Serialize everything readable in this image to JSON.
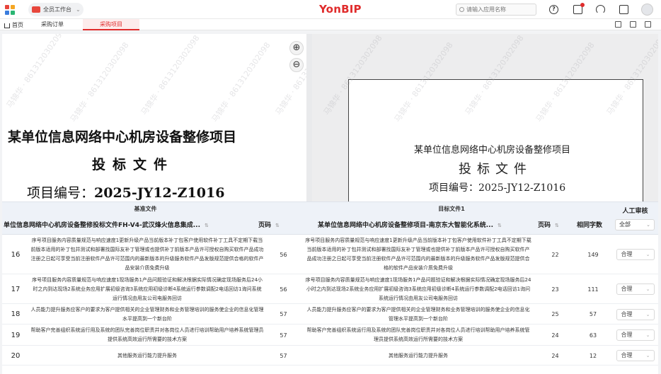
{
  "topbar": {
    "workspace_label": "全员工作台",
    "logo_text": "YonBIP",
    "search_placeholder": "请输入应用名称"
  },
  "tabs": {
    "home": "首页",
    "purchase_order": "采购订单",
    "purchase_project": "采购项目"
  },
  "left_doc": {
    "title": "某单位信息网络中心机房设备整修项目",
    "subtitle": "投标文件",
    "code_label": "项目编号：",
    "code_value": "2025-JY12-Z1016"
  },
  "right_doc": {
    "title": "某单位信息网络中心机房设备整修项目",
    "subtitle": "投标文件",
    "code": "项目编号：2025-JY12-Z1016"
  },
  "zoom": {
    "in_icon": "zoom-in-icon",
    "out_icon": "zoom-out-icon"
  },
  "watermark_text": "马锦华 · 8613120302098",
  "table": {
    "group_base": "基准文件",
    "group_target": "目标文件1",
    "manual_review": "人工审核",
    "base_file_name": "单位信息网络中心机房设备整修投标文件FH-V4-武汉烽火信息集成...",
    "base_page": "页码",
    "target_file_name": "某单位信息网络中心机房设备整修项目-南京东大智能化系统...",
    "target_page": "页码",
    "similar_chars": "相同字数",
    "filter_value": "全部",
    "rows": [
      {
        "idx": "16",
        "base_text": "序号项目服务内容质量规范与响应速度1更新升级产品当前版本补丁包客户使用软件补丁工具不定期下载当前版本适用的补丁包并测试和部署找国际友补丁管理或也提供补丁前版本产品许可授权自购买软件产品成功注册之日起可享受当前注册软件产品许可范围内的最新版本的升级服务软件产品发版规范提供合格的软件产品安装介质免费升级",
        "base_page": "56",
        "target_text": "序号项目服务内容质量规范与响应速度1更新升级产品当前版本补丁包客户使用软件补丁工具不定期下载当前版本适用的补丁包并测试和部署找国际友补丁管理或也提供补丁前版本产品许可授权自购买软件产品成功注册之日起可享受当前注册软件产品许可范围内的最新版本的升级服务软件产品发版规范提供合格的软件产品安装介质免费升级",
        "target_page": "22",
        "count": "149",
        "review": "合理"
      },
      {
        "idx": "17",
        "base_text": "序号项目服务内容质量规范与响应速度1现场服务1产品问题验证和解决根据实际情况确定现场服务后24小时之内到达现场2系统业务应用扩展初级咨询3系统应用初级诊断4系统运行参数调配2电话回访1询问系统运行情况由用友公司电服务回访",
        "base_page": "56",
        "target_text": "序号项目服务内容质量规范与响应速度1现场服务1产品问题验证和解决根据实际情况确定现场服务后24小时之内到达现场2系统业务应用扩展初级咨询3系统应用初级诊断4系统运行参数调配2电话回访1询问系统运行情况由用友公司电服务回访",
        "target_page": "23",
        "count": "111",
        "review": "合理"
      },
      {
        "idx": "18",
        "base_text": "人员能力提升服务应客户的要求为客户提供相关的企业管理财务和业务管理培训的服务使企业的信息化管理水平提高到一个新台阶",
        "base_page": "57",
        "target_text": "人员能力提升服务应客户的要求为客户提供相关的企业管理财务和业务管理培训的服务使企业的信息化管理水平提高到一个新台阶",
        "target_page": "25",
        "count": "57",
        "review": "合理"
      },
      {
        "idx": "19",
        "base_text": "帮助客户完善组织系统运行用及系统的团队完善岗位职责并对各岗位人员进行培训帮助用户培养系统管理员提供系统高效运行所需要的技术方案",
        "base_page": "57",
        "target_text": "帮助客户完善组织系统运行用及系统的团队完善岗位职责并对各岗位人员进行培训帮助用户培养系统管理员提供系统高效运行所需要的技术方案",
        "target_page": "24",
        "count": "63",
        "review": "合理"
      },
      {
        "idx": "20",
        "base_text": "其他服务运行能力提升服务",
        "base_page": "57",
        "target_text": "其他服务运行能力提升服务",
        "target_page": "24",
        "count": "12",
        "review": "合理"
      }
    ]
  },
  "colors": {
    "brand_red": "#e02c2c",
    "header_bg": "#eef2f8",
    "app_icon_colors": [
      "#e8453c",
      "#f5a623",
      "#3b7ddd",
      "#2bb673"
    ]
  }
}
